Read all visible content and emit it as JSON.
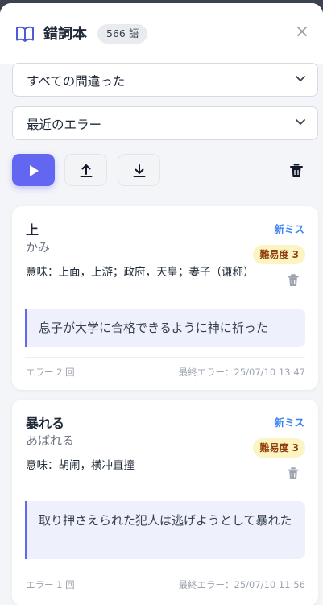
{
  "header": {
    "title": "錯詞本",
    "count": "566 語",
    "close_icon": "×"
  },
  "filters": {
    "scope": "すべての間違った",
    "sort": "最近のエラー"
  },
  "toolbar": {
    "play_icon": "play-icon",
    "upload_icon": "upload-icon",
    "download_icon": "download-icon",
    "trash_icon": "trash-icon",
    "accent_color": "#6366f1"
  },
  "cards": [
    {
      "word": "上",
      "reading": "かみ",
      "meaning": "意味：上面，上游；政府，天皇；妻子（谦称）",
      "status": "新ミス",
      "difficulty": "難易度 3",
      "example": "息子が大学に合格できるように神に祈った",
      "errors": "エラー 2 回",
      "last_error": "最終エラー：25/07/10 13:47"
    },
    {
      "word": "暴れる",
      "reading": "あばれる",
      "meaning": "意味：胡闹，横冲直撞",
      "status": "新ミス",
      "difficulty": "難易度 3",
      "example": "取り押さえられた犯人は逃げようとして暴れた",
      "errors": "エラー 1 回",
      "last_error": "最終エラー：25/07/10 11:56"
    }
  ]
}
